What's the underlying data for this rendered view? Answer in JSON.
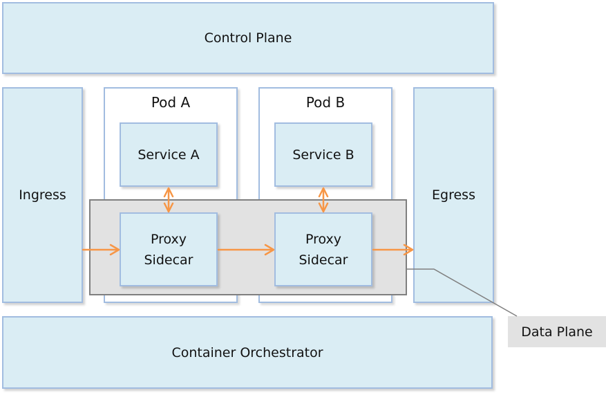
{
  "diagram": {
    "control_plane": "Control Plane",
    "ingress": "Ingress",
    "egress": "Egress",
    "container_orchestrator": "Container Orchestrator",
    "pods": [
      {
        "title": "Pod A",
        "service": "Service A",
        "proxy_line1": "Proxy",
        "proxy_line2": "Sidecar"
      },
      {
        "title": "Pod B",
        "service": "Service B",
        "proxy_line1": "Proxy",
        "proxy_line2": "Sidecar"
      }
    ],
    "data_plane_label": "Data Plane",
    "colors": {
      "box_fill": "#daedf4",
      "box_border": "#a1bce0",
      "data_plane_fill": "#e2e2e2",
      "data_plane_border": "#7f7f7f",
      "arrow": "#f79646"
    }
  }
}
